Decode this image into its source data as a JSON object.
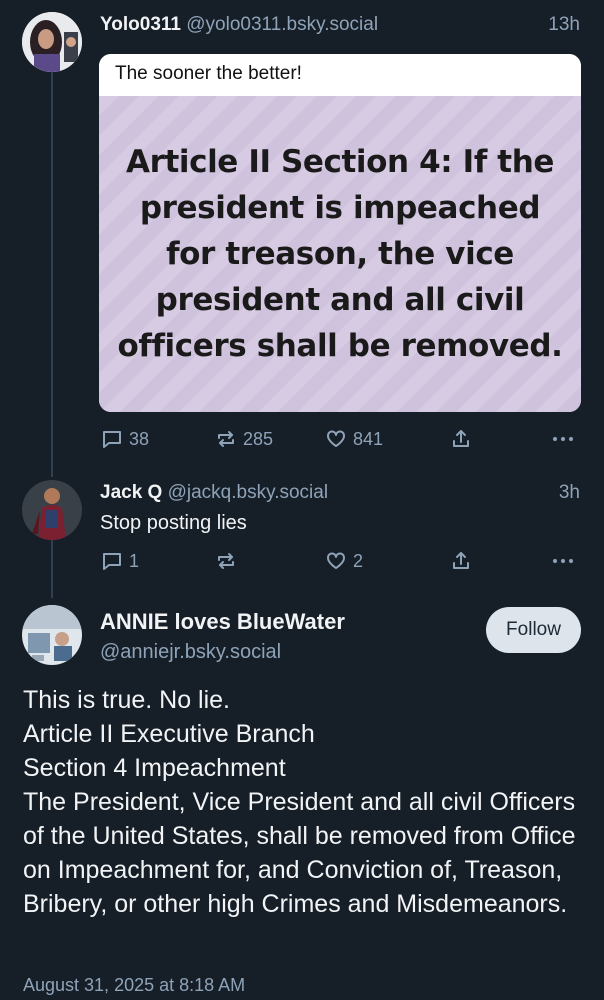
{
  "posts": {
    "first": {
      "display_name": "Yolo0311",
      "handle": "@yolo0311.bsky.social",
      "time": "13h",
      "quote_caption": "The sooner the better!",
      "image_text": "Article II Section 4: If the president is impeached for treason, the vice president and all civil officers shall be removed.",
      "replies": "38",
      "reposts": "285",
      "likes": "841"
    },
    "reply": {
      "display_name": "Jack Q",
      "handle": "@jackq.bsky.social",
      "time": "3h",
      "text": "Stop posting lies",
      "replies": "1",
      "likes": "2"
    },
    "main": {
      "display_name": "ANNIE loves BlueWater",
      "handle": "@anniejr.bsky.social",
      "follow_label": "Follow",
      "text": "This is true. No lie.\nArticle II  Executive Branch\nSection 4 Impeachment\nThe President, Vice President and all civil Officers of the United States, shall be removed from Office on Impeachment for, and Conviction of, Treason, Bribery, or other high Crimes and Misdemeanors.",
      "timestamp": "August 31, 2025 at 8:18 AM"
    }
  },
  "colors": {
    "background": "#161e27",
    "muted_text": "#8fa3b8",
    "thread_line": "#2e4052",
    "follow_button": "#dde4eb"
  },
  "icons": [
    "reply-icon",
    "repost-icon",
    "like-icon",
    "share-icon",
    "more-icon"
  ]
}
